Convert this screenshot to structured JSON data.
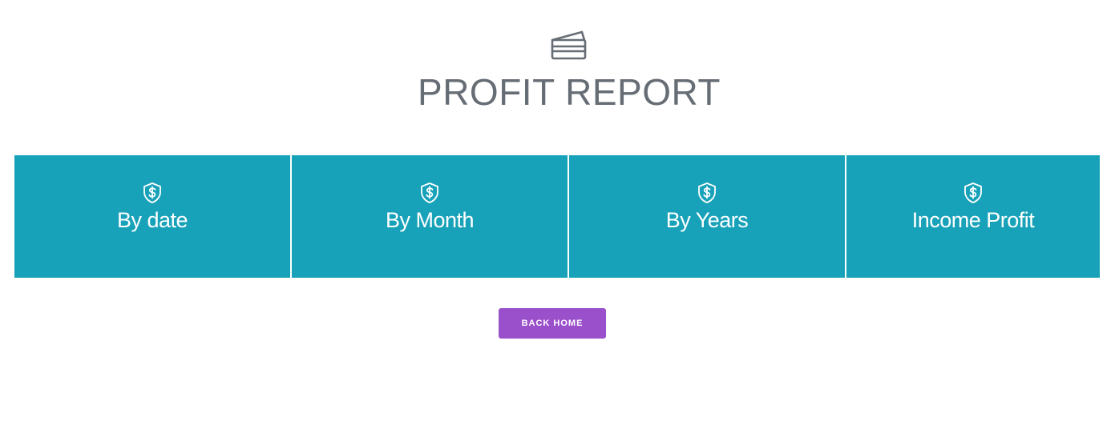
{
  "header": {
    "icon": "credit-card-icon",
    "title": "PROFIT REPORT"
  },
  "tiles": [
    {
      "label": "By date",
      "icon": "shield-dollar-icon"
    },
    {
      "label": "By Month",
      "icon": "shield-dollar-icon"
    },
    {
      "label": "By Years",
      "icon": "shield-dollar-icon"
    },
    {
      "label": "Income Profit",
      "icon": "shield-dollar-icon"
    }
  ],
  "actions": {
    "back_label": "BACK HOME"
  },
  "colors": {
    "tile_bg": "#18a2b9",
    "button_bg": "#9a4fcb",
    "title_text": "#666d75",
    "icon_stroke": "#666d75"
  }
}
